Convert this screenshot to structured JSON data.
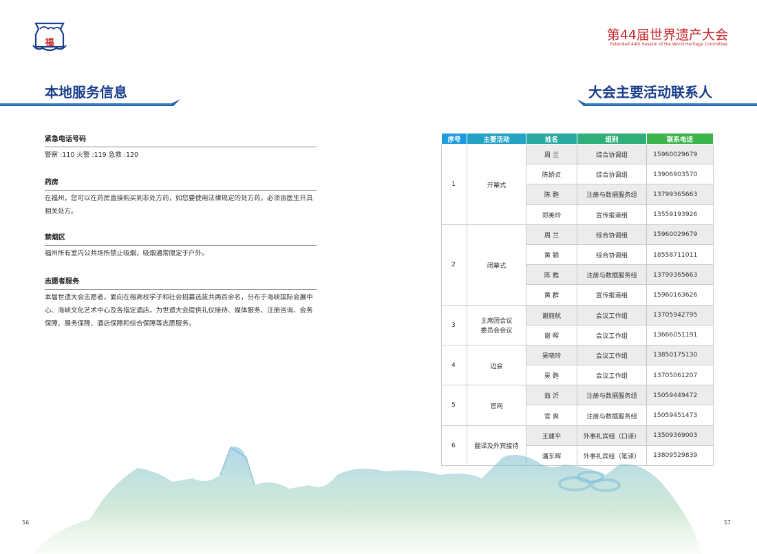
{
  "header": {
    "logo_char": "福",
    "event_title": "第44届世界遗产大会",
    "event_subtitle": "Extended 44th Session of the World Heritage Committee",
    "colors": {
      "brand_red": "#c8262b",
      "title_blue": "#1a3e8c",
      "header_gradient_start": "#1e9be0",
      "header_gradient_end": "#3cb44a"
    }
  },
  "left": {
    "title": "本地服务信息",
    "sections": [
      {
        "heading": "紧急电话号码",
        "body": "警察 :110  火警 :119  急救 :120"
      },
      {
        "heading": "药房",
        "body": "在福州，您可以在药房直接购买到非处方药，如您要使用法律规定的处方药，必须由医生开具相关处方。"
      },
      {
        "heading": "禁烟区",
        "body": "福州所有室内公共场所禁止吸烟，吸烟通常限定于户外。"
      },
      {
        "heading": "志愿者服务",
        "body": "本届世遗大会志愿者，面向在榕高校学子和社会招募选拔共两百余名，分布于海峡国际会展中心、海峡文化艺术中心及各指定酒店，为世遗大会提供礼仪接待、媒体服务、注册咨询、会务保障、展务保障、酒店保障和综合保障等志愿服务。"
      }
    ],
    "page_number": "56"
  },
  "right": {
    "title": "大会主要活动联系人",
    "table": {
      "headers": [
        "序号",
        "主要活动",
        "姓名",
        "组别",
        "联系电话"
      ],
      "groups": [
        {
          "seq": "1",
          "activity": "开幕式",
          "rows": [
            {
              "name": "周  兰",
              "group": "综合协调组",
              "phone": "15960029679"
            },
            {
              "name": "陈娇贞",
              "group": "综合协调组",
              "phone": "13906903570"
            },
            {
              "name": "陈  甦",
              "group": "注册与数据服务组",
              "phone": "13799365663"
            },
            {
              "name": "郑美玲",
              "group": "宣传报道组",
              "phone": "13559193926"
            }
          ]
        },
        {
          "seq": "2",
          "activity": "闭幕式",
          "rows": [
            {
              "name": "周  兰",
              "group": "综合协调组",
              "phone": "15960029679"
            },
            {
              "name": "黄  颖",
              "group": "综合协调组",
              "phone": "18558711011"
            },
            {
              "name": "陈  甦",
              "group": "注册与数据服务组",
              "phone": "13799365663"
            },
            {
              "name": "黄  群",
              "group": "宣传报道组",
              "phone": "15960163626"
            }
          ]
        },
        {
          "seq": "3",
          "activity": "主席团会议\n委员会会议",
          "rows": [
            {
              "name": "谢丽航",
              "group": "会议工作组",
              "phone": "13705942795"
            },
            {
              "name": "谢  晖",
              "group": "会议工作组",
              "phone": "13666051191"
            }
          ]
        },
        {
          "seq": "4",
          "activity": "边会",
          "rows": [
            {
              "name": "吴晓玲",
              "group": "会议工作组",
              "phone": "13850175130"
            },
            {
              "name": "吴  甦",
              "group": "会议工作组",
              "phone": "13705061207"
            }
          ]
        },
        {
          "seq": "5",
          "activity": "官网",
          "rows": [
            {
              "name": "翁  沂",
              "group": "注册与数据服务组",
              "phone": "15059449472"
            },
            {
              "name": "官  爽",
              "group": "注册与数据服务组",
              "phone": "15059451473"
            }
          ]
        },
        {
          "seq": "6",
          "activity": "翻译及外宾接待",
          "rows": [
            {
              "name": "王建平",
              "group": "外事礼宾组（口译）",
              "phone": "13509369003"
            },
            {
              "name": "潘东晖",
              "group": "外事礼宾组（笔译）",
              "phone": "13809529839"
            }
          ]
        }
      ]
    },
    "page_number": "57"
  }
}
